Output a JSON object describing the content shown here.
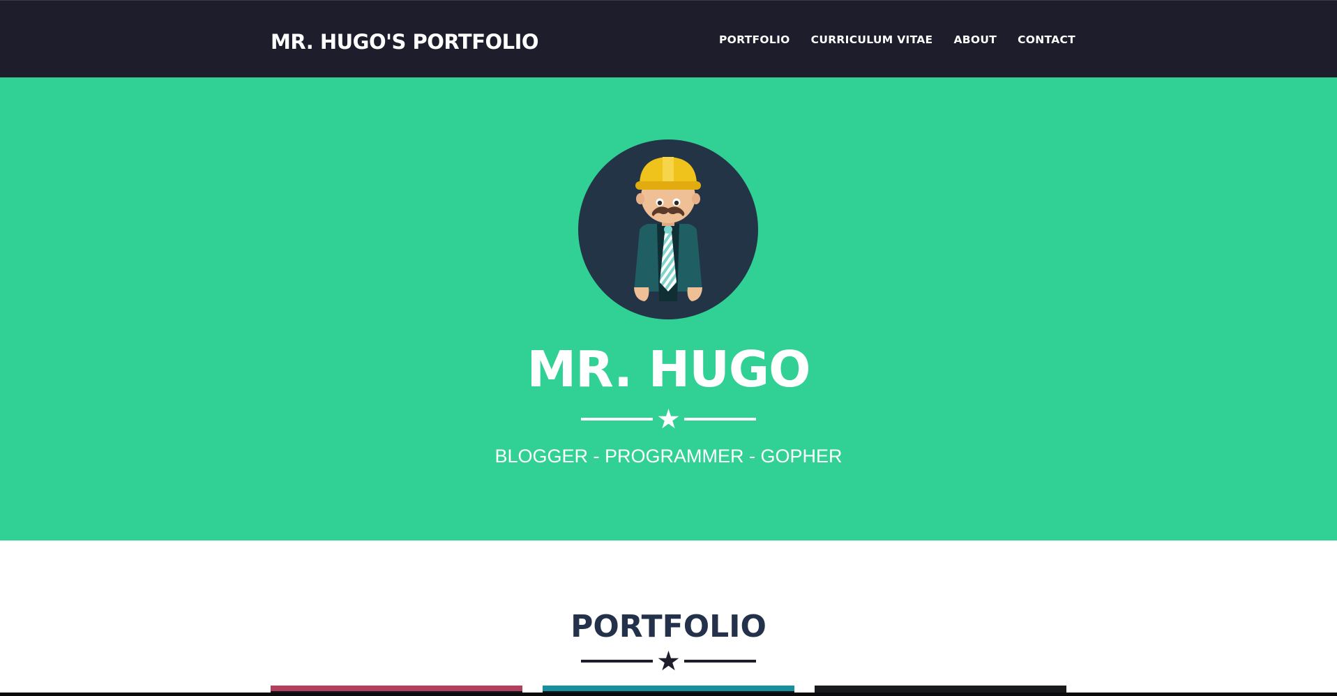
{
  "navbar": {
    "brand": "MR. HUGO'S PORTFOLIO",
    "links": [
      "PORTFOLIO",
      "CURRICULUM VITAE",
      "ABOUT",
      "CONTACT"
    ]
  },
  "hero": {
    "name": "MR. HUGO",
    "tagline": "BLOGGER - PROGRAMMER - GOPHER"
  },
  "portfolio": {
    "title": "PORTFOLIO"
  },
  "colors": {
    "navbar_bg": "#1d1d2b",
    "hero_bg": "#31d195",
    "heading_dark": "#23314a",
    "card_1": "#b33f5c",
    "card_2": "#17909d",
    "card_3": "#1a1a1a"
  },
  "icons": [
    "avatar-illustration",
    "star-icon"
  ]
}
